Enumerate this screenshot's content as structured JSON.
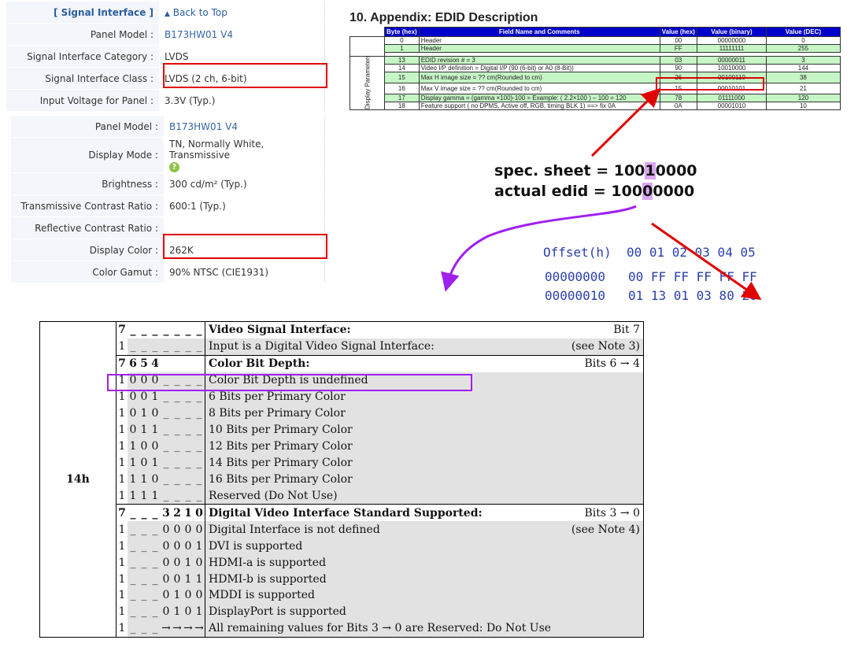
{
  "panel_top": {
    "header_label": "[ Signal Interface ]",
    "back_to_top": "Back to Top",
    "rows": [
      {
        "key": "Panel Model :",
        "value": "B173HW01 V4"
      },
      {
        "key": "Signal Interface Category :",
        "value": "LVDS"
      },
      {
        "key": "Signal Interface Class :",
        "value": "LVDS (2 ch, 6-bit)"
      },
      {
        "key": "Input Voltage for Panel :",
        "value": "3.3V (Typ.)"
      }
    ]
  },
  "panel_bottom": {
    "rows": [
      {
        "key": "Panel Model :",
        "value": "B173HW01 V4"
      },
      {
        "key": "Display Mode :",
        "value": "TN, Normally White, Transmissive"
      },
      {
        "key": "Brightness :",
        "value": "300 cd/m² (Typ.)"
      },
      {
        "key": "Transmissive Contrast Ratio :",
        "value": "600:1 (Typ.)"
      },
      {
        "key": "Reflective Contrast Ratio :",
        "value": ""
      },
      {
        "key": "Display Color :",
        "value": "262K"
      },
      {
        "key": "Color Gamut :",
        "value": "90% NTSC (CIE1931)"
      }
    ]
  },
  "appendix": {
    "title": "10. Appendix: EDID Description",
    "headers": [
      "Byte (hex)",
      "Field Name and Comments",
      "Value (hex)",
      "Value (binary)",
      "Value (DEC)"
    ],
    "side_label": "Display Parameters",
    "rows": [
      {
        "byte": "0",
        "field": "Header",
        "hex": "00",
        "bin": "00000000",
        "dec": "0"
      },
      {
        "byte": "1",
        "field": "Header",
        "hex": "FF",
        "bin": "11111111",
        "dec": "255"
      },
      {
        "byte": "13",
        "field": "EDID revision # = 3",
        "hex": "03",
        "bin": "00000011",
        "dec": "3"
      },
      {
        "byte": "14",
        "field": "Video I/P definition = Digital I/P (90 (6-bit) or A0 (8-Bit))",
        "hex": "90",
        "bin": "10010000",
        "dec": "144"
      },
      {
        "byte": "15",
        "field": "Max H image size = ?? cm(Rounded to cm)",
        "hex": "26",
        "bin": "00100110",
        "dec": "38"
      },
      {
        "byte": "16",
        "field": "Max V image size = ?? cm(Rounded to cm)",
        "hex": "15",
        "bin": "00010101",
        "dec": "21"
      },
      {
        "byte": "17",
        "field": "Display gamma = (gamma ×100)-100 = Example: ( 2.2×100 ) – 100 = 120",
        "hex": "78",
        "bin": "01111000",
        "dec": "120"
      },
      {
        "byte": "18",
        "field": "Feature support ( no DPMS, Active off, RGB, timing BLK 1) ==> fix 0A",
        "hex": "0A",
        "bin": "00001010",
        "dec": "10"
      }
    ]
  },
  "comparison": {
    "spec_prefix": "spec. sheet = 100",
    "spec_hl": "1",
    "spec_suffix": "0000",
    "actual_prefix": "actual edid = 100",
    "actual_hl": "0",
    "actual_suffix": "0000"
  },
  "hexdump": {
    "header": "Offset(h)  00 01 02 03 04 05",
    "rows": [
      "00000000   00 FF FF FF FF FF",
      "00000010   01 13 01 03 80 26"
    ]
  },
  "bits": {
    "offset": "14h",
    "rows": [
      {
        "bits": [
          "7",
          "_",
          "_",
          "_",
          "_",
          "_",
          "_",
          "_"
        ],
        "desc": "Video Signal Interface:",
        "right": "Bit 7",
        "bold": true,
        "gray": false
      },
      {
        "bits": [
          "1",
          "_",
          "_",
          "_",
          "_",
          "_",
          "_",
          "_"
        ],
        "desc": "Input is a Digital Video Signal Interface:",
        "right": "(see Note 3)",
        "bold": false,
        "gray": true
      },
      {
        "bits": [
          "7",
          "6",
          "5",
          "4",
          "",
          "",
          "",
          ""
        ],
        "desc": "Color Bit Depth:",
        "right": "Bits 6 → 4",
        "bold": true,
        "gray": false
      },
      {
        "bits": [
          "1",
          "0",
          "0",
          "0",
          "_",
          "_",
          "_",
          "_"
        ],
        "desc": "Color Bit Depth is undefined",
        "right": "",
        "bold": false,
        "gray": true
      },
      {
        "bits": [
          "1",
          "0",
          "0",
          "1",
          "_",
          "_",
          "_",
          "_"
        ],
        "desc": "6 Bits per Primary Color",
        "right": "",
        "bold": false,
        "gray": true
      },
      {
        "bits": [
          "1",
          "0",
          "1",
          "0",
          "_",
          "_",
          "_",
          "_"
        ],
        "desc": "8 Bits per Primary Color",
        "right": "",
        "bold": false,
        "gray": true
      },
      {
        "bits": [
          "1",
          "0",
          "1",
          "1",
          "_",
          "_",
          "_",
          "_"
        ],
        "desc": "10 Bits per Primary Color",
        "right": "",
        "bold": false,
        "gray": true
      },
      {
        "bits": [
          "1",
          "1",
          "0",
          "0",
          "_",
          "_",
          "_",
          "_"
        ],
        "desc": "12 Bits per Primary Color",
        "right": "",
        "bold": false,
        "gray": true
      },
      {
        "bits": [
          "1",
          "1",
          "0",
          "1",
          "_",
          "_",
          "_",
          "_"
        ],
        "desc": "14 Bits per Primary Color",
        "right": "",
        "bold": false,
        "gray": true
      },
      {
        "bits": [
          "1",
          "1",
          "1",
          "0",
          "_",
          "_",
          "_",
          "_"
        ],
        "desc": "16 Bits per Primary Color",
        "right": "",
        "bold": false,
        "gray": true
      },
      {
        "bits": [
          "1",
          "1",
          "1",
          "1",
          "_",
          "_",
          "_",
          "_"
        ],
        "desc": "Reserved (Do Not Use)",
        "right": "",
        "bold": false,
        "gray": true
      },
      {
        "bits": [
          "7",
          "_",
          "_",
          "_",
          "3",
          "2",
          "1",
          "0"
        ],
        "desc": "Digital Video Interface Standard Supported:",
        "right": "Bits 3 → 0",
        "bold": true,
        "gray": false
      },
      {
        "bits": [
          "1",
          "_",
          "_",
          "_",
          "0",
          "0",
          "0",
          "0"
        ],
        "desc": "Digital Interface is not defined",
        "right": "(see Note 4)",
        "bold": false,
        "gray": true
      },
      {
        "bits": [
          "1",
          "_",
          "_",
          "_",
          "0",
          "0",
          "0",
          "1"
        ],
        "desc": "DVI is supported",
        "right": "",
        "bold": false,
        "gray": true
      },
      {
        "bits": [
          "1",
          "_",
          "_",
          "_",
          "0",
          "0",
          "1",
          "0"
        ],
        "desc": "HDMI-a is supported",
        "right": "",
        "bold": false,
        "gray": true
      },
      {
        "bits": [
          "1",
          "_",
          "_",
          "_",
          "0",
          "0",
          "1",
          "1"
        ],
        "desc": "HDMI-b is supported",
        "right": "",
        "bold": false,
        "gray": true
      },
      {
        "bits": [
          "1",
          "_",
          "_",
          "_",
          "0",
          "1",
          "0",
          "0"
        ],
        "desc": "MDDI is supported",
        "right": "",
        "bold": false,
        "gray": true
      },
      {
        "bits": [
          "1",
          "_",
          "_",
          "_",
          "0",
          "1",
          "0",
          "1"
        ],
        "desc": "DisplayPort is supported",
        "right": "",
        "bold": false,
        "gray": true
      },
      {
        "bits": [
          "1",
          "_",
          "_",
          "_",
          "→",
          "→",
          "→",
          "→"
        ],
        "desc": "All remaining values for Bits 3 → 0 are Reserved: Do Not Use",
        "right": "",
        "bold": false,
        "gray": true
      }
    ]
  },
  "colors": {
    "highlight_red": "#e00000",
    "highlight_purple": "#a020f0",
    "link_blue": "#2a5d9e",
    "edid_header_blue": "#0000cc",
    "edid_row_green": "#c6f5c6"
  }
}
